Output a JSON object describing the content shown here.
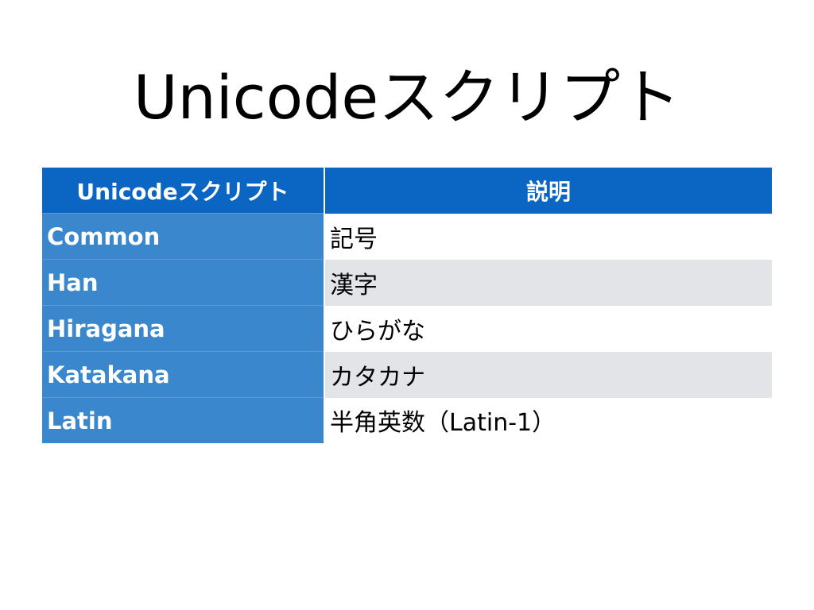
{
  "slide": {
    "title": "Unicodeスクリプト"
  },
  "table": {
    "headers": [
      "Unicodeスクリプト",
      "説明"
    ],
    "rows": [
      {
        "name": "Common",
        "description": "記号"
      },
      {
        "name": "Han",
        "description": "漢字"
      },
      {
        "name": "Hiragana",
        "description": "ひらがな"
      },
      {
        "name": "Katakana",
        "description": "カタカナ"
      },
      {
        "name": "Latin",
        "description": "半角英数（Latin-1）"
      }
    ]
  },
  "colors": {
    "header_background": "#0a66c2",
    "name_column_background": "#3a87cd",
    "row_stripe": "#e3e4e8",
    "text_light": "#ffffff",
    "text_dark": "#000000"
  }
}
